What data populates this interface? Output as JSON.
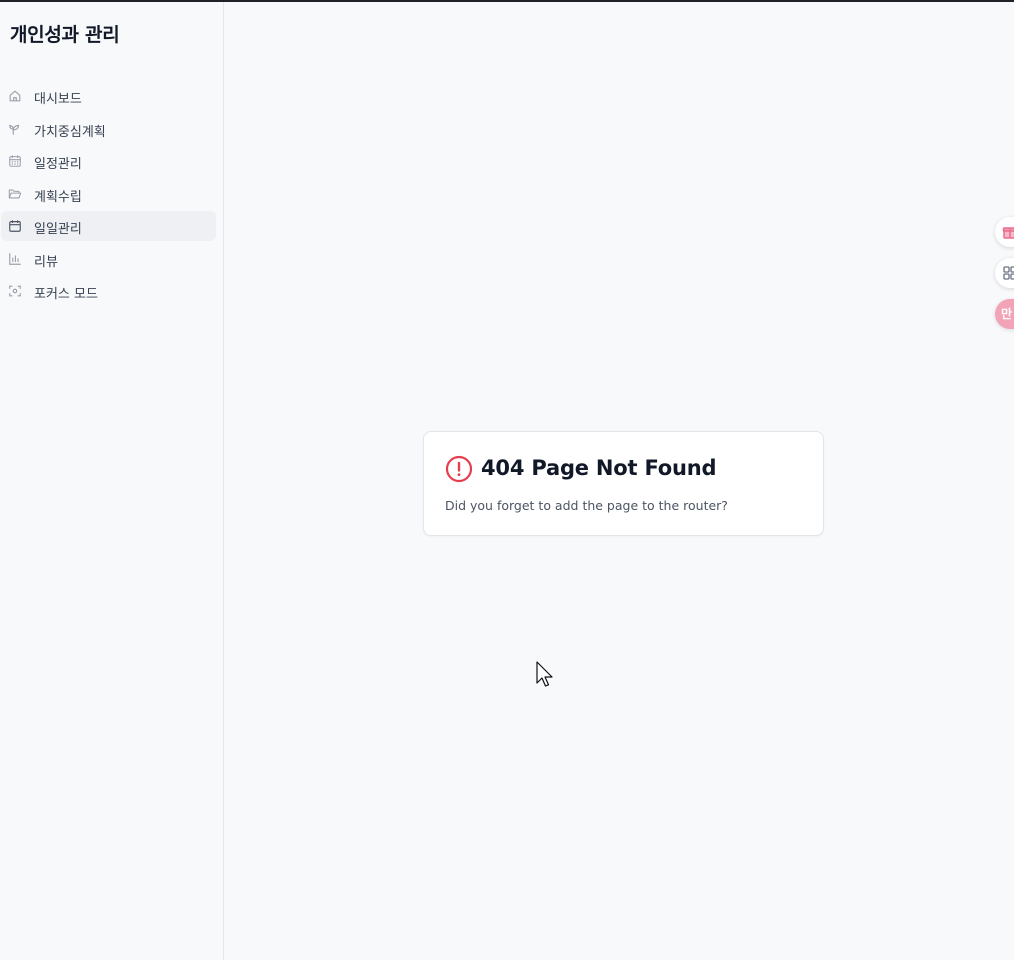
{
  "app": {
    "title": "개인성과 관리"
  },
  "sidebar": {
    "items": [
      {
        "label": "대시보드",
        "icon": "home-icon",
        "active": false
      },
      {
        "label": "가치중심계획",
        "icon": "sprout-icon",
        "active": false
      },
      {
        "label": "일정관리",
        "icon": "calendar-grid-icon",
        "active": false
      },
      {
        "label": "계획수립",
        "icon": "folder-open-icon",
        "active": false
      },
      {
        "label": "일일관리",
        "icon": "calendar-icon",
        "active": true
      },
      {
        "label": "리뷰",
        "icon": "bar-chart-icon",
        "active": false
      },
      {
        "label": "포커스 모드",
        "icon": "focus-icon",
        "active": false
      }
    ]
  },
  "error_card": {
    "title": "404 Page Not Found",
    "message": "Did you forget to add the page to the router?",
    "icon": "alert-circle-icon",
    "icon_color": "#e53e4f"
  },
  "floating_buttons": [
    {
      "icon": "gift-icon"
    },
    {
      "icon": "grid-icon"
    },
    {
      "icon": "chat-icon",
      "text": "만"
    }
  ],
  "colors": {
    "accent_error": "#e53e4f",
    "sidebar_active_bg": "#eef0f3",
    "pink": "#f3a3b8"
  }
}
